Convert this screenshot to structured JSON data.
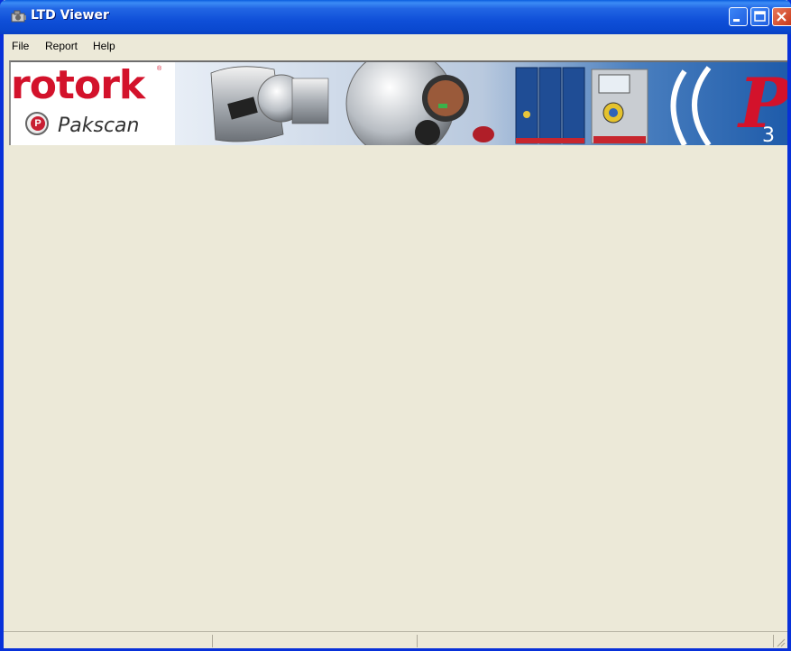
{
  "window": {
    "title": "LTD Viewer",
    "icon": "app-icon"
  },
  "menu": {
    "items": [
      {
        "label": "File"
      },
      {
        "label": "Report"
      },
      {
        "label": "Help"
      }
    ]
  },
  "banner": {
    "brand": "rotork",
    "product": "Pakscan",
    "product_badge": "P",
    "series_mark": "P3"
  },
  "colors": {
    "titlebar_blue": "#0A49D0",
    "brand_red": "#D3122B",
    "window_bg": "#ECE9D8"
  },
  "statusbar": {
    "panes": [
      "",
      "",
      ""
    ]
  }
}
